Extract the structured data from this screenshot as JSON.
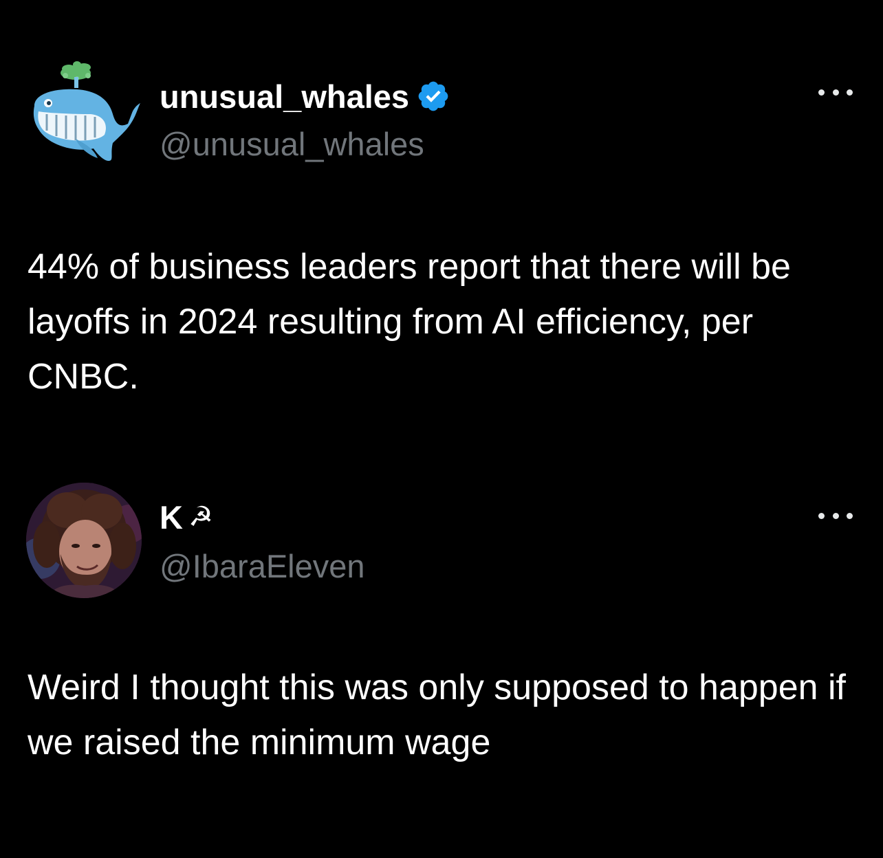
{
  "tweets": [
    {
      "display_name": "unusual_whales",
      "handle": "@unusual_whales",
      "verified": true,
      "avatar_icon": "whale-logo-icon",
      "text": "44% of business leaders report that there will be layoffs in 2024 resulting from AI efficiency, per CNBC."
    },
    {
      "display_name": "K",
      "name_emoji": "☭",
      "handle": "@IbaraEleven",
      "verified": false,
      "avatar_icon": "user-photo-avatar",
      "text": "Weird I thought this was only supposed to happen if we raised the minimum wage"
    }
  ],
  "colors": {
    "background": "#000000",
    "text": "#ffffff",
    "secondary_text": "#71767b",
    "verified_blue": "#1d9bf0"
  },
  "icons": {
    "more": "more-options-icon",
    "verified": "verified-badge-icon"
  }
}
